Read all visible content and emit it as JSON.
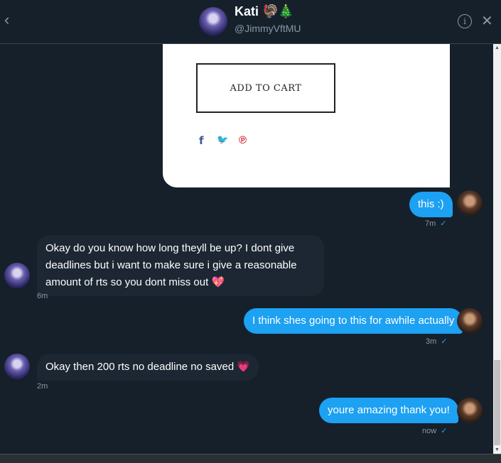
{
  "header": {
    "name": "Kati 🦃🎄",
    "handle": "@JimmyVftMU",
    "back_icon": "‹",
    "info_icon": "i",
    "close_icon": "✕"
  },
  "card": {
    "button_label": "ADD TO CART",
    "share": [
      {
        "icon": "facebook-icon",
        "glyph": "f",
        "color": "#3b5998"
      },
      {
        "icon": "twitter-icon",
        "glyph": "🐦",
        "color": "#1da1f2"
      },
      {
        "icon": "pinterest-icon",
        "glyph": "℗",
        "color": "#cb2027"
      }
    ]
  },
  "messages": [
    {
      "dir": "out",
      "text": "this :)",
      "time": "7m",
      "check": "✓"
    },
    {
      "dir": "in",
      "text": "Okay do you know how long theyll be up? I dont give deadlines but i want to make sure i give a reasonable amount of rts so you dont miss out 💖",
      "time": "6m"
    },
    {
      "dir": "out",
      "text": "I think shes going to this for awhile actually",
      "time": "3m",
      "check": "✓"
    },
    {
      "dir": "in",
      "text": "Okay then 200 rts no deadline no saved 💗",
      "time": "2m"
    },
    {
      "dir": "out",
      "text": "youre amazing thank you!",
      "time": "now",
      "check": "✓"
    }
  ],
  "colors": {
    "accent": "#1da1f2",
    "background": "#15202b",
    "incoming_bubble": "#1c2733"
  }
}
